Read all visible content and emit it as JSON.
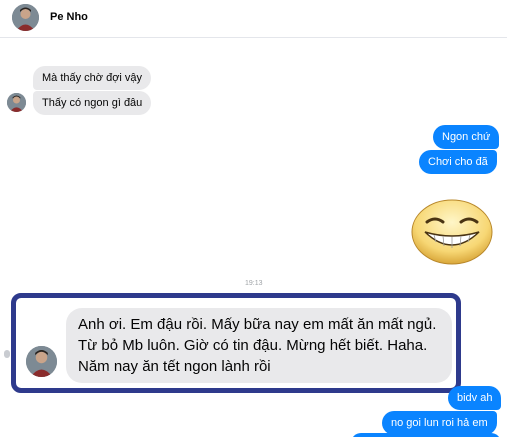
{
  "header": {
    "contact_name": "Pe Nho"
  },
  "messages": {
    "incoming": [
      "Mà thấy chờ đợi vậy",
      "Thấy có ngon gì đâu"
    ],
    "outgoing_top": [
      "Ngon chứ",
      "Chơi cho đã"
    ],
    "timestamp": "19:13",
    "highlighted_incoming": "Anh ơi. Em đậu rồi. Mấy bữa nay em mất ăn mất ngủ. Từ bỏ Mb luôn. Giờ có tin đậu. Mừng hết biết. Haha. Năm nay ăn tết ngon lành rồi",
    "outgoing_bottom": [
      "bidv ah",
      "no goi lun roi hả em"
    ]
  },
  "colors": {
    "outgoing_bubble": "#0a84ff",
    "incoming_bubble": "#e9e9eb",
    "highlight_border": "#2e3a8c"
  },
  "icons": {
    "sticker": "grinning-face-sticker",
    "avatar": "contact-avatar"
  }
}
